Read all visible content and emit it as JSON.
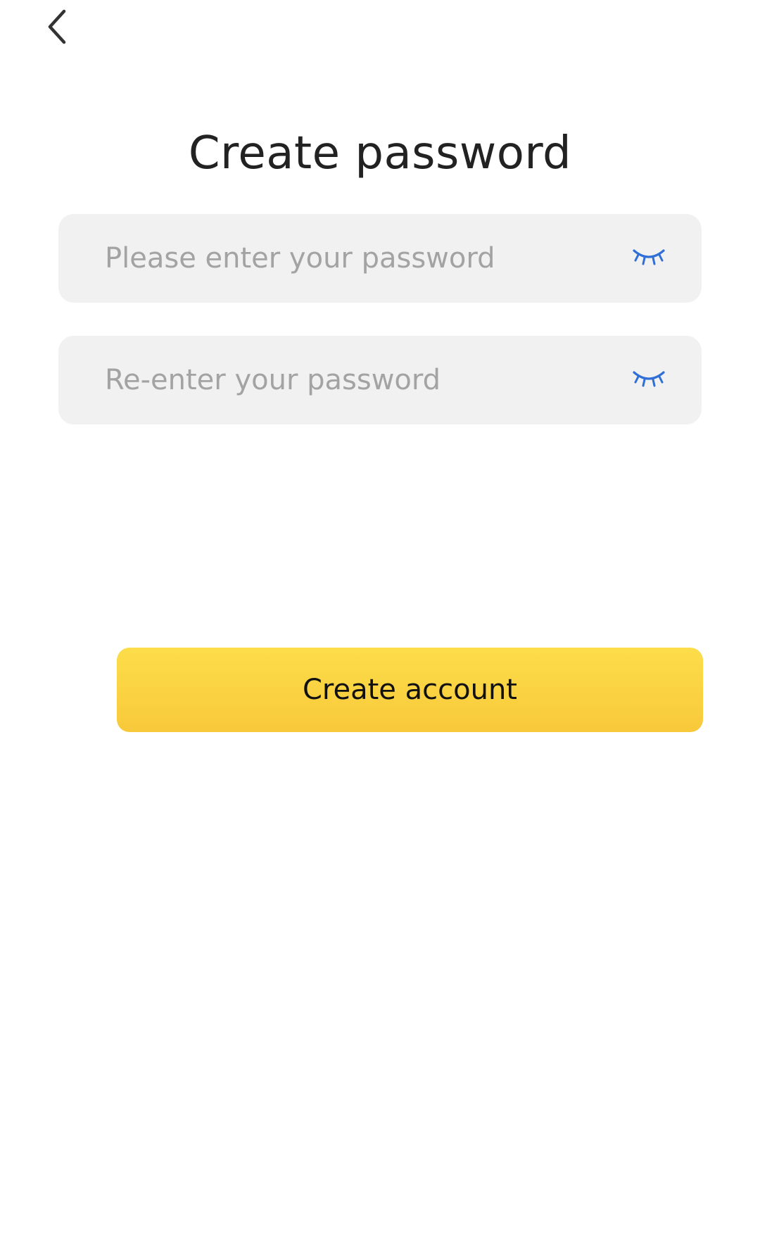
{
  "header": {
    "back_icon": "chevron-left-icon"
  },
  "title": "Create password",
  "fields": [
    {
      "placeholder": "Please enter your password",
      "value": "",
      "toggle_icon": "eye-closed-icon"
    },
    {
      "placeholder": "Re-enter your password",
      "value": "",
      "toggle_icon": "eye-closed-icon"
    }
  ],
  "primary_button": {
    "label": "Create account"
  },
  "colors": {
    "accent_yellow": "#fcd843",
    "eye_icon_blue": "#2f6fd6",
    "field_background": "#f1f1f1",
    "placeholder_gray": "#a3a3a3"
  }
}
